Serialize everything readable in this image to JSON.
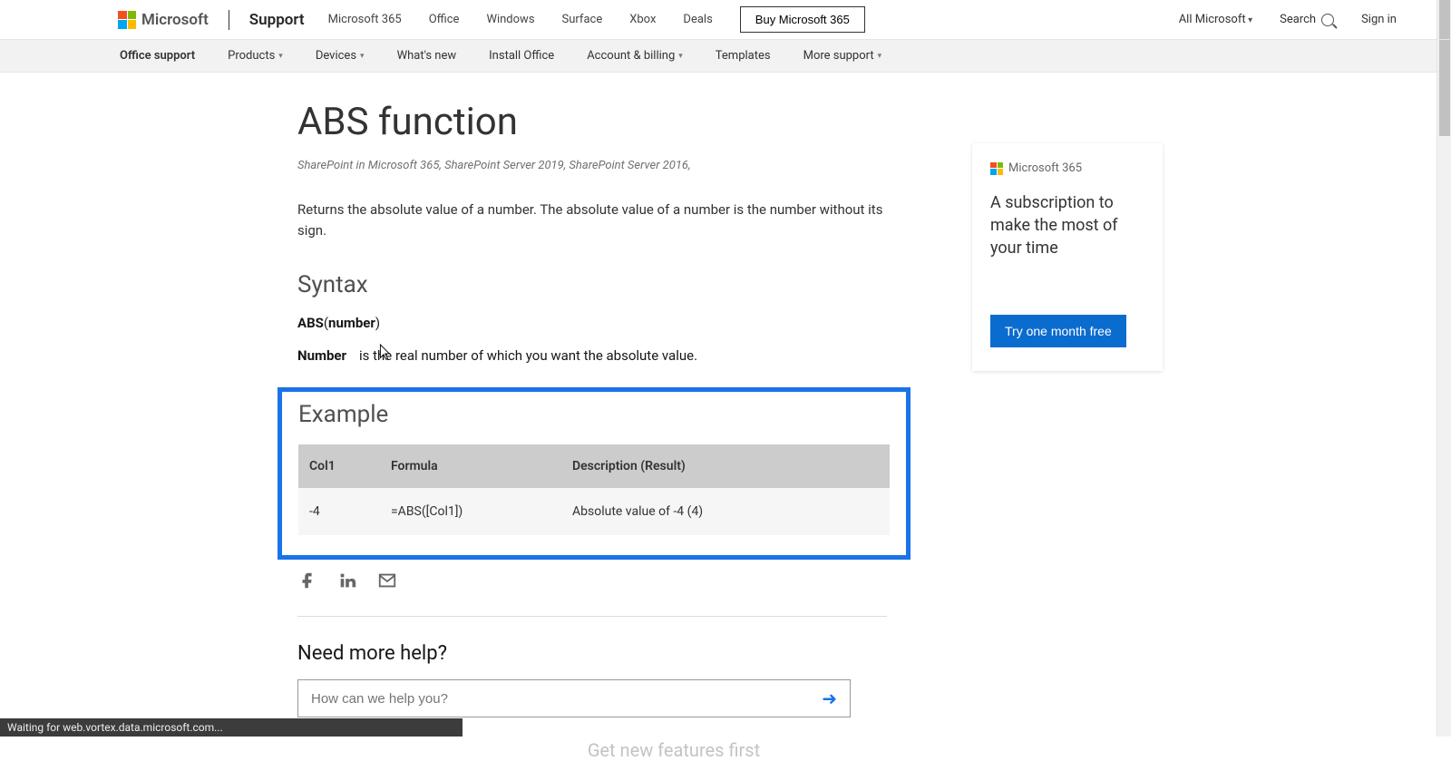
{
  "top": {
    "brand": "Microsoft",
    "support": "Support",
    "nav": [
      "Microsoft 365",
      "Office",
      "Windows",
      "Surface",
      "Xbox",
      "Deals"
    ],
    "buy": "Buy Microsoft 365",
    "all": "All Microsoft",
    "search": "Search",
    "signin": "Sign in"
  },
  "sub": {
    "items": [
      {
        "label": "Office support",
        "bold": true,
        "caret": false
      },
      {
        "label": "Products",
        "caret": true
      },
      {
        "label": "Devices",
        "caret": true
      },
      {
        "label": "What's new",
        "caret": false
      },
      {
        "label": "Install Office",
        "caret": false
      },
      {
        "label": "Account & billing",
        "caret": true
      },
      {
        "label": "Templates",
        "caret": false
      },
      {
        "label": "More support",
        "caret": true
      }
    ]
  },
  "article": {
    "title": "ABS function",
    "applies": "SharePoint in Microsoft 365, SharePoint Server 2019, SharePoint Server 2016,",
    "intro": "Returns the absolute value of a number. The absolute value of a number is the number without its sign.",
    "syntax_h": "Syntax",
    "sig_fn": "ABS",
    "sig_arg": "number",
    "param_name": "Number",
    "param_desc": "is the real number of which you want the absolute value.",
    "example_h": "Example",
    "table": {
      "headers": [
        "Col1",
        "Formula",
        "Description (Result)"
      ],
      "rows": [
        [
          "-4",
          "=ABS([Col1])",
          "Absolute value of -4 (4)"
        ]
      ]
    },
    "help_h": "Need more help?",
    "help_ph": "How can we help you?",
    "get_new": "Get new features first"
  },
  "promo": {
    "head": "Microsoft 365",
    "text": "A subscription to make the most of your time",
    "cta": "Try one month free"
  },
  "status": "Waiting for web.vortex.data.microsoft.com..."
}
